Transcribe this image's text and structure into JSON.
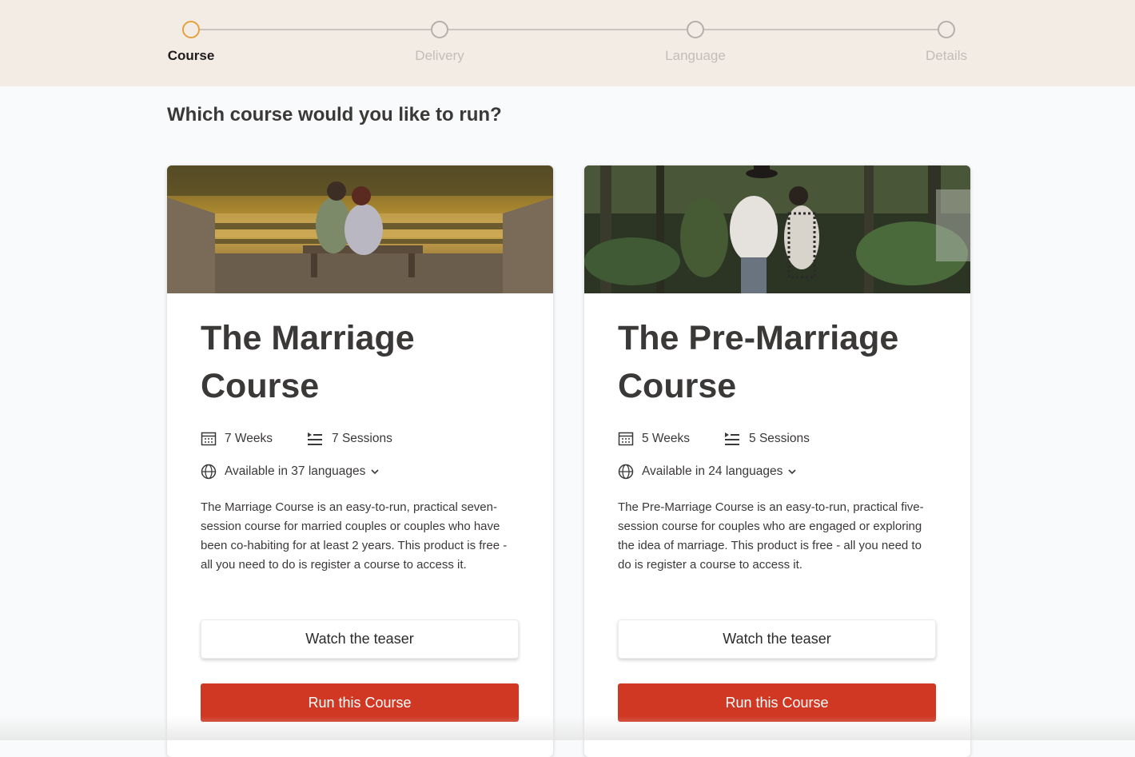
{
  "stepper": {
    "steps": [
      {
        "label": "Course",
        "active": true
      },
      {
        "label": "Delivery",
        "active": false
      },
      {
        "label": "Language",
        "active": false
      },
      {
        "label": "Details",
        "active": false
      }
    ]
  },
  "heading": "Which course would you like to run?",
  "courses": [
    {
      "title": "The Marriage Course",
      "weeks": "7 Weeks",
      "sessions": "7 Sessions",
      "languages": "Available in 37 languages",
      "description": "The Marriage Course is an easy-to-run, practical seven-session course for married couples or couples who have been co-habiting for at least 2 years. This product is free - all you need to do is register a course to access it.",
      "teaser_label": "Watch the teaser",
      "run_label": "Run this Course"
    },
    {
      "title": "The Pre-Marriage Course",
      "weeks": "5 Weeks",
      "sessions": "5 Sessions",
      "languages": "Available in 24 languages",
      "description": "The Pre-Marriage Course is an easy-to-run, practical five-session course for couples who are engaged or exploring the idea of marriage. This product is free - all you need to do is register a course to access it.",
      "teaser_label": "Watch the teaser",
      "run_label": "Run this Course"
    }
  ],
  "colors": {
    "accent_step": "#e3a23c",
    "primary_button": "#d03823",
    "stepper_background": "#f3ece5"
  },
  "icons": [
    "calendar-icon",
    "sessions-list-icon",
    "globe-icon",
    "chevron-down-icon"
  ]
}
